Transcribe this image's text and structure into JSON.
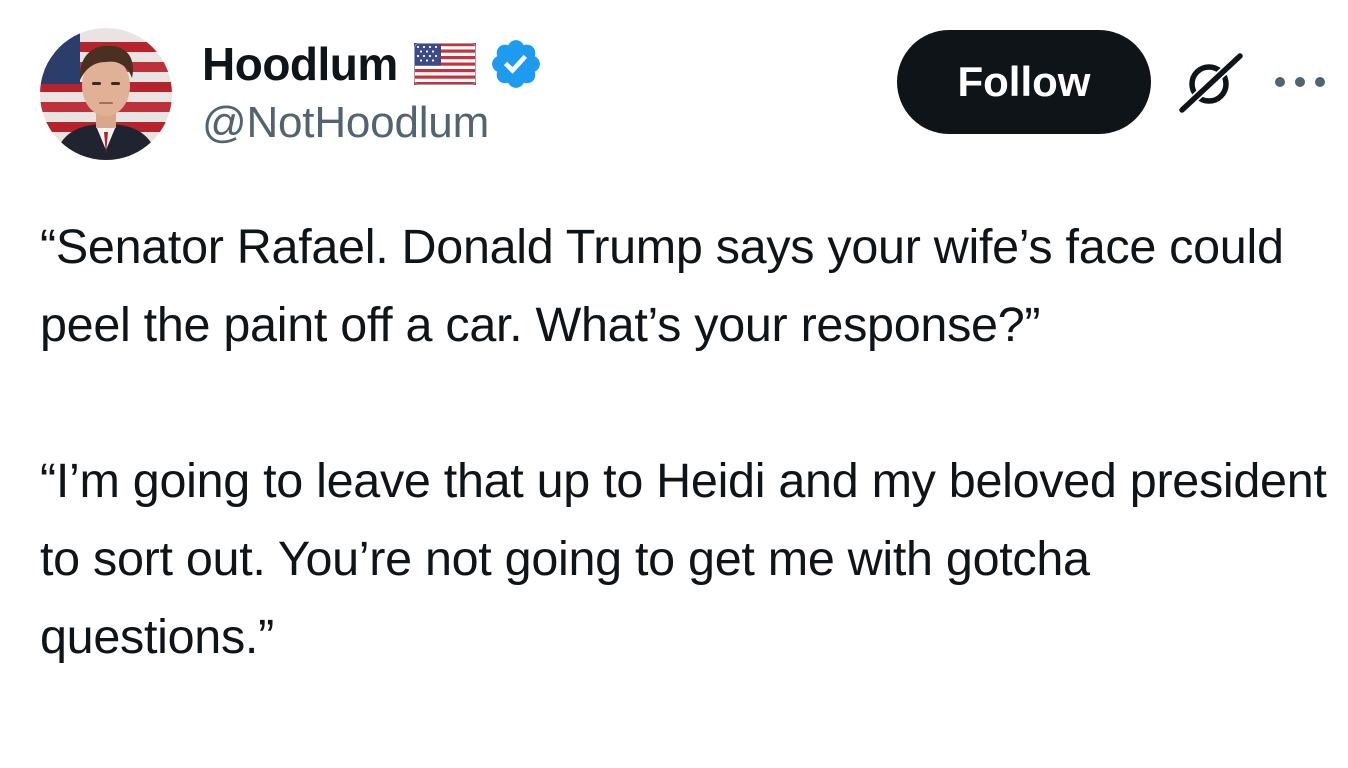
{
  "tweet": {
    "author": {
      "display_name": "Hoodlum",
      "handle": "@NotHoodlum",
      "avatar_icon": "profile-photo",
      "flag_icon": "us-flag-icon",
      "verified_icon": "verified-badge-icon",
      "verified_color": "#1d9bf0"
    },
    "actions": {
      "follow_label": "Follow",
      "grok_icon": "grok-icon",
      "more_icon": "more-dots-icon"
    },
    "paragraphs": [
      "“Senator Rafael. Donald Trump says your wife’s face could peel the paint off a car. What’s your response?”",
      "“I’m going to leave that up to Heidi and my beloved president to sort out. You’re not going to get me with gotcha questions.”"
    ]
  },
  "colors": {
    "text_primary": "#0f1419",
    "text_secondary": "#536471",
    "follow_bg": "#0f1419",
    "follow_text": "#ffffff",
    "background": "#ffffff"
  }
}
